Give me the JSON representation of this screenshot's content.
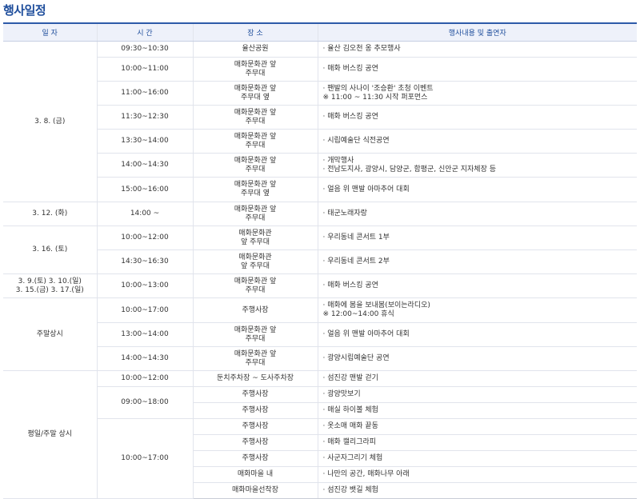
{
  "title": "행사일정",
  "headers": [
    "일 자",
    "시 간",
    "장 소",
    "행사내용 및 출연자"
  ],
  "blocks": [
    {
      "date": [
        "3. 8. (금)"
      ],
      "rows": [
        {
          "time": "09:30~10:30",
          "place": [
            "율산공원"
          ],
          "content": [
            "· 율산 김오천 옹 추모행사"
          ]
        },
        {
          "time": "10:00~11:00",
          "place": [
            "매화문화관 앞",
            "주무대"
          ],
          "content": [
            "· 매화 버스킹 공연"
          ]
        },
        {
          "time": "11:00~16:00",
          "place": [
            "매화문화관 앞",
            "주무대 옆"
          ],
          "content": [
            "· 팬발의 사나이 '조승환' 초청 이벤트",
            "※ 11:00 ~ 11:30 시작 퍼포먼스"
          ]
        },
        {
          "time": "11:30~12:30",
          "place": [
            "매화문화관 앞",
            "주무대"
          ],
          "content": [
            "· 매화 버스킹 공연"
          ]
        },
        {
          "time": "13:30~14:00",
          "place": [
            "매화문화관 앞",
            "주무대"
          ],
          "content": [
            "· 시립예술단 식전공연"
          ]
        },
        {
          "time": "14:00~14:30",
          "place": [
            "매화문화관 앞",
            "주무대"
          ],
          "content": [
            "· 개막행사",
            "· 전남도지사, 광양시, 담양군, 함평군, 신안군 지자체장 등"
          ]
        },
        {
          "time": "15:00~16:00",
          "place": [
            "매화문화관 앞",
            "주무대 옆"
          ],
          "content": [
            "· 얼음 위 맨발 아마추어 대회"
          ]
        }
      ]
    },
    {
      "date": [
        "3. 12. (화)"
      ],
      "rows": [
        {
          "time": "14:00 ~",
          "place": [
            "매화문화관 앞",
            "주무대"
          ],
          "content": [
            "· 태군노래자랑"
          ]
        }
      ]
    },
    {
      "date": [
        "3. 16. (토)"
      ],
      "rows": [
        {
          "time": "10:00~12:00",
          "place": [
            "매화문화관",
            "앞 주무대"
          ],
          "content": [
            "· 우리동네 콘서트 1부"
          ]
        },
        {
          "time": "14:30~16:30",
          "place": [
            "매화문화관",
            "앞 주무대"
          ],
          "content": [
            "· 우리동네 콘서트 2부"
          ]
        }
      ]
    },
    {
      "date": [
        "3. 9.(토) 3. 10.(일)",
        "3. 15.(금) 3. 17.(일)"
      ],
      "rows": [
        {
          "time": "10:00~13:00",
          "place": [
            "매화문화관 앞",
            "주무대"
          ],
          "content": [
            "· 매화 버스킹 공연"
          ]
        }
      ]
    },
    {
      "date": [
        "주말상시"
      ],
      "rows": [
        {
          "time": "10:00~17:00",
          "place": [
            "주행사장"
          ],
          "content": [
            "· 매화에 봄을 보내봄(보이는라디오)",
            "※ 12:00~14:00 휴식"
          ]
        },
        {
          "time": "13:00~14:00",
          "place": [
            "매화문화관 앞",
            "주무대"
          ],
          "content": [
            "· 얼음 위 맨발 아마추어 대회"
          ]
        },
        {
          "time": "14:00~14:30",
          "place": [
            "매화문화관 앞",
            "주무대"
          ],
          "content": [
            "· 광양시립예술단 공연"
          ]
        }
      ]
    },
    {
      "date": [
        "평일/주말 상시"
      ],
      "rows": [
        {
          "time": "10:00~12:00",
          "place": [
            "둔치주차장 ~ 도사주차장"
          ],
          "content": [
            "· 섬진강 맨발 걷기"
          ]
        },
        {
          "time": "09:00~18:00",
          "place": [
            "주행사장"
          ],
          "content": [
            "· 광양맛보기"
          ]
        },
        {
          "time": null,
          "place": [
            "주행사장"
          ],
          "content": [
            "· 매실 하이볼 체험"
          ]
        },
        {
          "time": "10:00~17:00",
          "place": [
            "주행사장"
          ],
          "content": [
            "· 옷소매 매화 끝동"
          ]
        },
        {
          "time": null,
          "place": [
            "주행사장"
          ],
          "content": [
            "· 매화 캘리그라피"
          ]
        },
        {
          "time": null,
          "place": [
            "주행사장"
          ],
          "content": [
            "· 사군자그리기 체험"
          ]
        },
        {
          "time": null,
          "place": [
            "매화마을 내"
          ],
          "content": [
            "· 나만의 공간, 매화나무 아래"
          ]
        },
        {
          "time": null,
          "place": [
            "매화마을선착장"
          ],
          "content": [
            "· 섬진강 뱃길 체험"
          ]
        }
      ]
    }
  ]
}
